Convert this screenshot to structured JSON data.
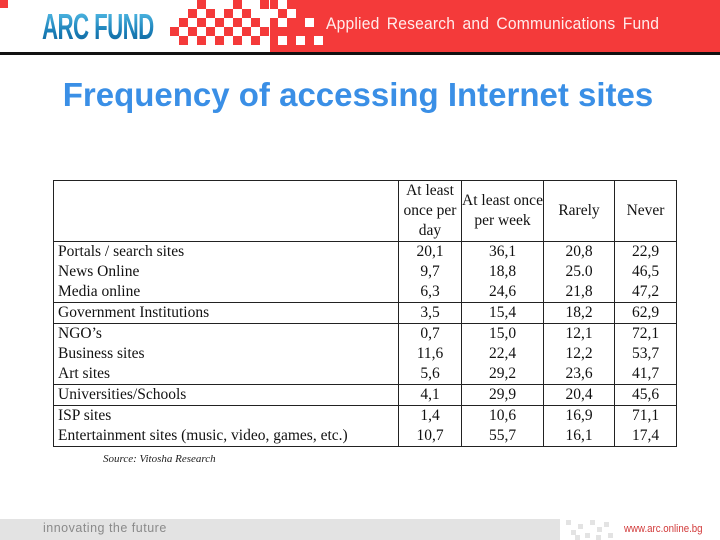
{
  "header": {
    "logo_text": "ARC FUND",
    "tagline": "Applied Research and Communications Fund",
    "brand_red": "#f43a3a",
    "logo_blue": "#1e8fc4"
  },
  "slide": {
    "title": "Frequency of accessing Internet sites",
    "title_color": "#3a8fe6"
  },
  "table": {
    "columns": [
      "",
      "At least once per day",
      "At least once per week",
      "Rarely",
      "Never"
    ],
    "rows": [
      {
        "label": "Portals / search sites",
        "values": [
          "20,1",
          "36,1",
          "20,8",
          "22,9"
        ]
      },
      {
        "label": "News Online",
        "values": [
          "9,7",
          "18,8",
          "25.0",
          "46,5"
        ]
      },
      {
        "label": "Media online",
        "values": [
          "6,3",
          "24,6",
          "21,8",
          "47,2"
        ]
      },
      {
        "label": "Government Institutions",
        "values": [
          "3,5",
          "15,4",
          "18,2",
          "62,9"
        ]
      },
      {
        "label": "NGO’s",
        "values": [
          "0,7",
          "15,0",
          "12,1",
          "72,1"
        ]
      },
      {
        "label": "Business sites",
        "values": [
          "11,6",
          "22,4",
          "12,2",
          "53,7"
        ]
      },
      {
        "label": "Art sites",
        "values": [
          "5,6",
          "29,2",
          "23,6",
          "41,7"
        ]
      },
      {
        "label": "Universities/Schools",
        "values": [
          "4,1",
          "29,9",
          "20,4",
          "45,6"
        ]
      },
      {
        "label": "ISP sites",
        "values": [
          "1,4",
          "10,6",
          "16,9",
          "71,1"
        ]
      },
      {
        "label": "Entertainment sites (music, video, games, etc.)",
        "values": [
          "10,7",
          "55,7",
          "16,1",
          "17,4"
        ]
      }
    ],
    "source": "Source: Vitosha Research"
  },
  "footer": {
    "tagline": "innovating the future",
    "url": "www.arc.online.bg"
  }
}
